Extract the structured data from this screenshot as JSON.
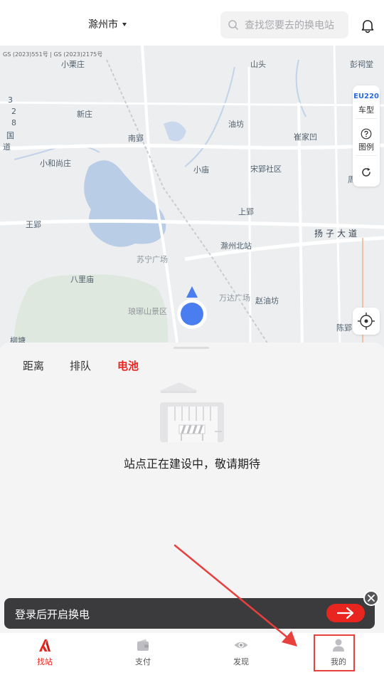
{
  "header": {
    "city": "滁州市",
    "search_placeholder": "查找您要去的换电站"
  },
  "map": {
    "credit": "GS (2023)551号 | GS (2023)2175号",
    "labels": {
      "shandou": "山头",
      "penghetang": "彭祠堂",
      "xinzhuang": "新庄",
      "youfang": "油坊",
      "cuijiaao": "崔家凹",
      "nanying": "南郢",
      "xiaohe": "小和尚庄",
      "xiaomiao": "小庙",
      "songying": "宋郢社区",
      "wangying": "王郢",
      "shangying": "上郢",
      "yangzi": "扬子大道",
      "chuzhoubei": "滁州北站",
      "suning": "苏宁广场",
      "balimiao": "八里庙",
      "wanda": "万达广场",
      "zhaoyoufang": "赵油坊",
      "langya": "琅琊山景区",
      "chenying": "陈郢",
      "liutang": "柳塘",
      "guodao_num": [
        "3",
        "2",
        "8"
      ],
      "guodao_txt": [
        "国",
        "道"
      ],
      "xiaoyangzhuang": "小栗庄",
      "zhou": "周"
    }
  },
  "tools": {
    "model": "EU220",
    "model_label": "车型",
    "legend_label": "图例"
  },
  "tabs": [
    "距离",
    "排队",
    "电池"
  ],
  "active_tab": "电池",
  "empty_text": "站点正在建设中，敬请期待",
  "banner": {
    "text": "登录后开启换电"
  },
  "nav": {
    "items": [
      {
        "label": "找站",
        "icon": "brand-logo-icon"
      },
      {
        "label": "支付",
        "icon": "wallet-icon"
      },
      {
        "label": "发现",
        "icon": "eye-icon"
      },
      {
        "label": "我的",
        "icon": "person-icon"
      }
    ],
    "active": "找站"
  },
  "colors": {
    "accent": "#e8261f",
    "location": "#4a7ef0",
    "tool_text": "#2a6be0",
    "banner_bg": "#3b3b3d"
  }
}
